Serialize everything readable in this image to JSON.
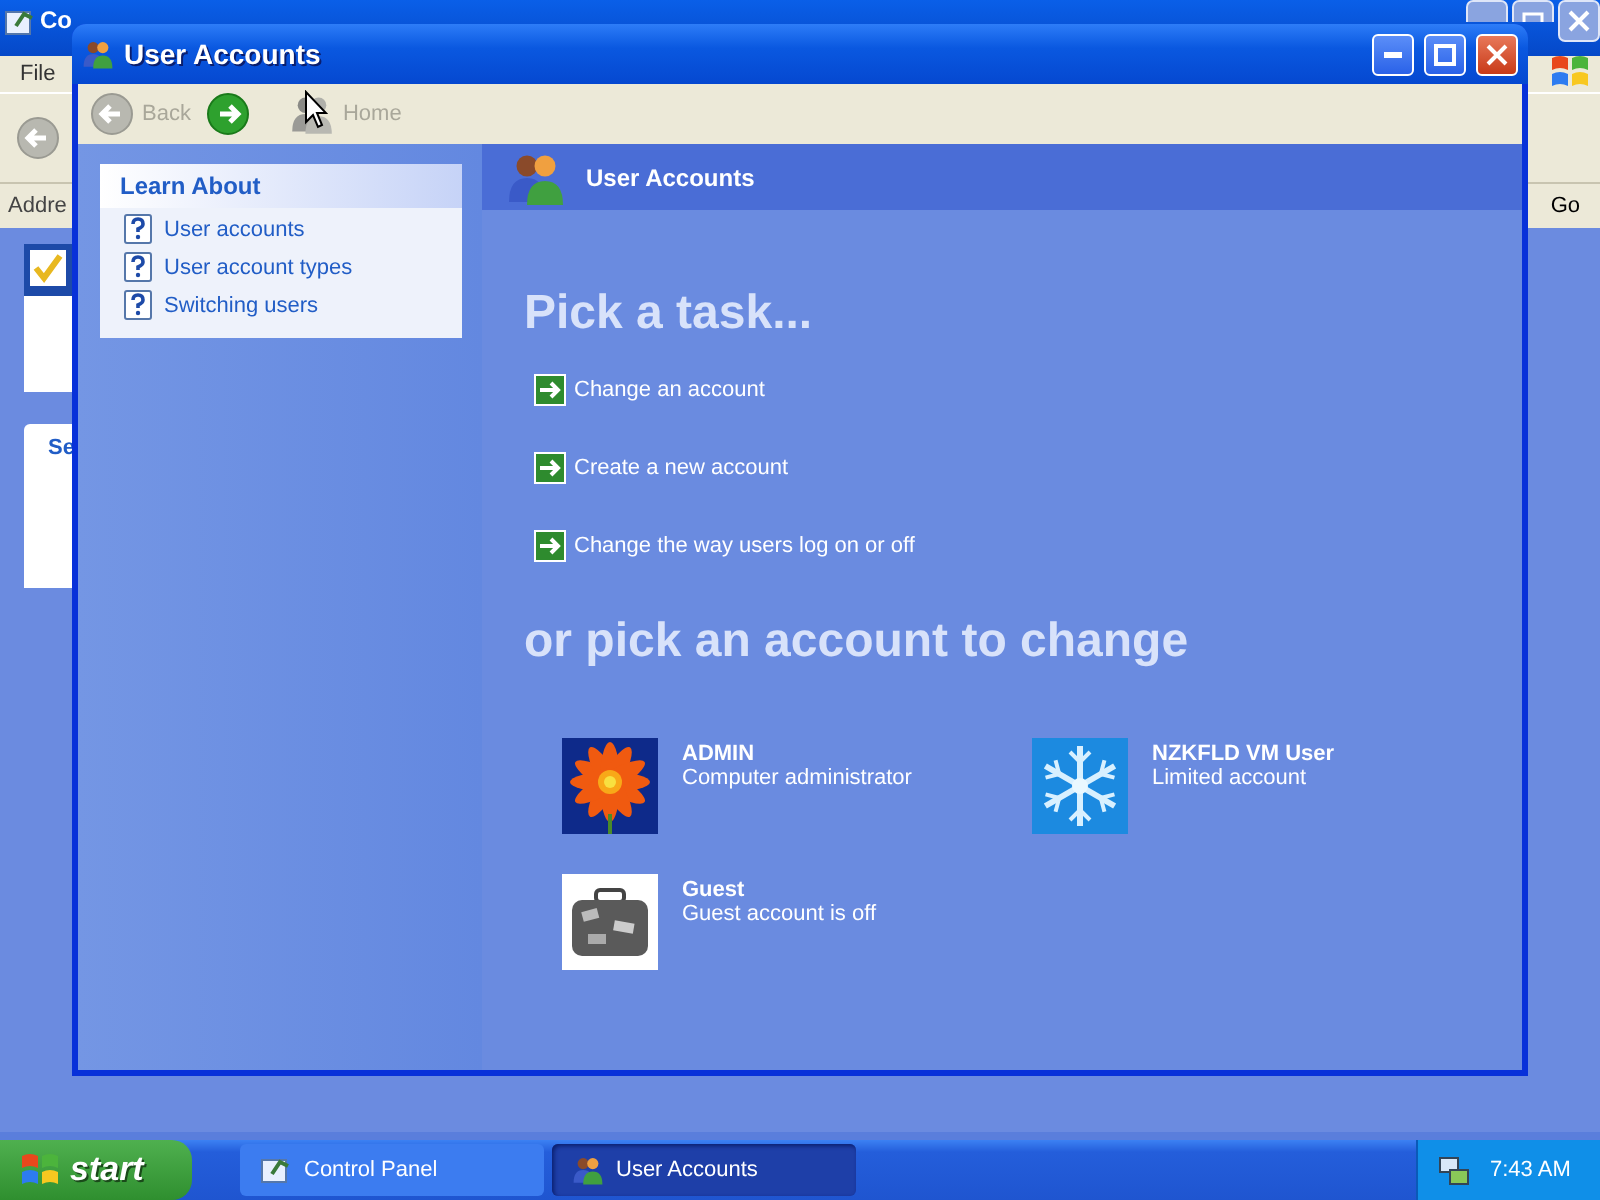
{
  "background_window": {
    "title": "Co",
    "menu": [
      "File"
    ],
    "address_label": "Addre",
    "go_button": "Go",
    "panel_title": "Se"
  },
  "window": {
    "title": "User Accounts"
  },
  "toolbar": [
    {
      "kind": "back",
      "label": "Back",
      "disabled": true
    },
    {
      "kind": "forward",
      "disabled": false
    },
    {
      "kind": "home",
      "label": "Home",
      "disabled": true
    }
  ],
  "learn_about": {
    "title": "Learn About",
    "items": [
      "User accounts",
      "User account types",
      "Switching users"
    ]
  },
  "header": "User Accounts",
  "task_heading": "Pick a task...",
  "tasks": [
    "Change an account",
    "Create a new account",
    "Change the way users log on or off"
  ],
  "account_heading": "or pick an account to change",
  "accounts": [
    {
      "name": "ADMIN",
      "type": "Computer administrator"
    },
    {
      "name": "NZKFLD VM User",
      "type": "Limited account"
    },
    {
      "name": "Guest",
      "type": "Guest account is off"
    }
  ],
  "taskbar": {
    "start": "start",
    "buttons": [
      {
        "label": "Control Panel",
        "selected": false
      },
      {
        "label": "User Accounts",
        "selected": true
      }
    ],
    "clock": "7:43 AM"
  }
}
